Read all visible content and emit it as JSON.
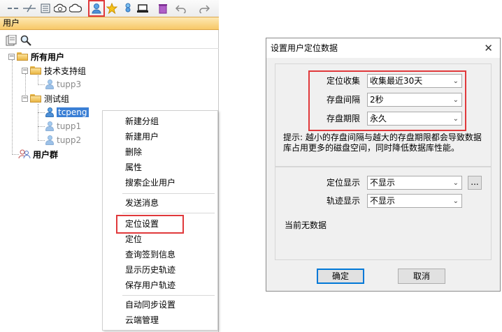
{
  "toolbar": {
    "icons": [
      "dash-icon",
      "cut-icon",
      "grid-icon",
      "refresh-cloud-icon",
      "cloud-icon",
      "user-icon",
      "star-icon",
      "users-icon",
      "laptop-icon",
      "trash-icon",
      "undo-icon",
      "redo-icon"
    ]
  },
  "panel": {
    "title": "用户"
  },
  "tree": {
    "root": "所有用户",
    "group1": "技术支持组",
    "group1_user": "tupp3",
    "group2": "测试组",
    "group2_users": [
      "tcpeng",
      "tupp1",
      "tupp2"
    ],
    "group_users": "用户群"
  },
  "context_menu": {
    "items": [
      "新建分组",
      "新建用户",
      "删除",
      "属性",
      "搜索企业用户",
      "发送消息",
      "定位设置",
      "定位",
      "查询签到信息",
      "显示历史轨迹",
      "保存用户轨迹",
      "自动同步设置",
      "云端管理"
    ]
  },
  "dialog": {
    "title": "设置用户定位数据",
    "close": "✕",
    "collect_label": "定位收集",
    "collect_value": "收集最近30天",
    "interval_label": "存盘间隔",
    "interval_value": "2秒",
    "period_label": "存盘期限",
    "period_value": "永久",
    "hint": "提示: 越小的存盘间隔与越大的存盘期限都会导致数据库占用更多的磁盘空间，同时降低数据库性能。",
    "display_label": "定位显示",
    "display_value": "不显示",
    "more_button": "...",
    "track_label": "轨迹显示",
    "track_value": "不显示",
    "status": "当前无数据",
    "ok": "确定",
    "cancel": "取消"
  },
  "colors": {
    "highlight": "#e0393b",
    "header": "#f7c867",
    "selection": "#3a7fd5"
  }
}
